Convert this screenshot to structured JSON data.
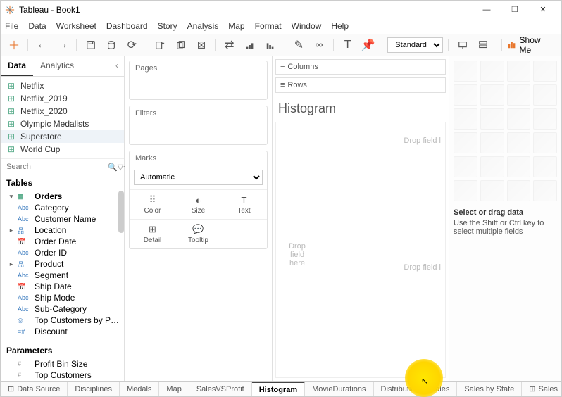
{
  "title": "Tableau - Book1",
  "window_controls": {
    "minimize": "—",
    "maximize": "❐",
    "close": "✕"
  },
  "menu": [
    "File",
    "Data",
    "Worksheet",
    "Dashboard",
    "Story",
    "Analysis",
    "Map",
    "Format",
    "Window",
    "Help"
  ],
  "toolbar": {
    "fit_dropdown": "Standard",
    "showme": "Show Me"
  },
  "side_tabs": {
    "data": "Data",
    "analytics": "Analytics"
  },
  "data_sources": [
    "Netflix",
    "Netflix_2019",
    "Netflix_2020",
    "Olympic Medalists",
    "Superstore",
    "World Cup"
  ],
  "search_placeholder": "Search",
  "tables_header": "Tables",
  "tables_root": "Orders",
  "fields": [
    {
      "icon": "Abc",
      "label": "Category"
    },
    {
      "icon": "Abc",
      "label": "Customer Name"
    },
    {
      "icon": "geo",
      "label": "Location",
      "expandable": true
    },
    {
      "icon": "date",
      "label": "Order Date"
    },
    {
      "icon": "Abc",
      "label": "Order ID"
    },
    {
      "icon": "hier",
      "label": "Product",
      "expandable": true
    },
    {
      "icon": "Abc",
      "label": "Segment"
    },
    {
      "icon": "date",
      "label": "Ship Date"
    },
    {
      "icon": "Abc",
      "label": "Ship Mode"
    },
    {
      "icon": "Abc",
      "label": "Sub-Category"
    },
    {
      "icon": "set",
      "label": "Top Customers by P…"
    },
    {
      "icon": "calc",
      "label": "Discount"
    }
  ],
  "parameters_header": "Parameters",
  "parameters": [
    {
      "label": "Profit Bin Size"
    },
    {
      "label": "Top Customers"
    }
  ],
  "cards": {
    "pages": "Pages",
    "filters": "Filters",
    "marks": "Marks",
    "marks_type": "Automatic",
    "mark_cells": [
      "Color",
      "Size",
      "Text",
      "Detail",
      "Tooltip"
    ]
  },
  "shelves": {
    "columns": "Columns",
    "rows": "Rows"
  },
  "viz_title": "Histogram",
  "drop_hints": {
    "r1": "Drop field l",
    "r2": "Drop field l",
    "c": "Drop field here"
  },
  "showme": {
    "title": "Select or drag data",
    "sub": "Use the Shift or Ctrl key to select multiple fields"
  },
  "bottom_tabs": {
    "data_source": "Data Source",
    "tabs": [
      "Disciplines",
      "Medals",
      "Map",
      "SalesVSProfit",
      "Histogram",
      "MovieDurations",
      "Distribution of Sales",
      "Sales by State",
      "Sales"
    ]
  }
}
